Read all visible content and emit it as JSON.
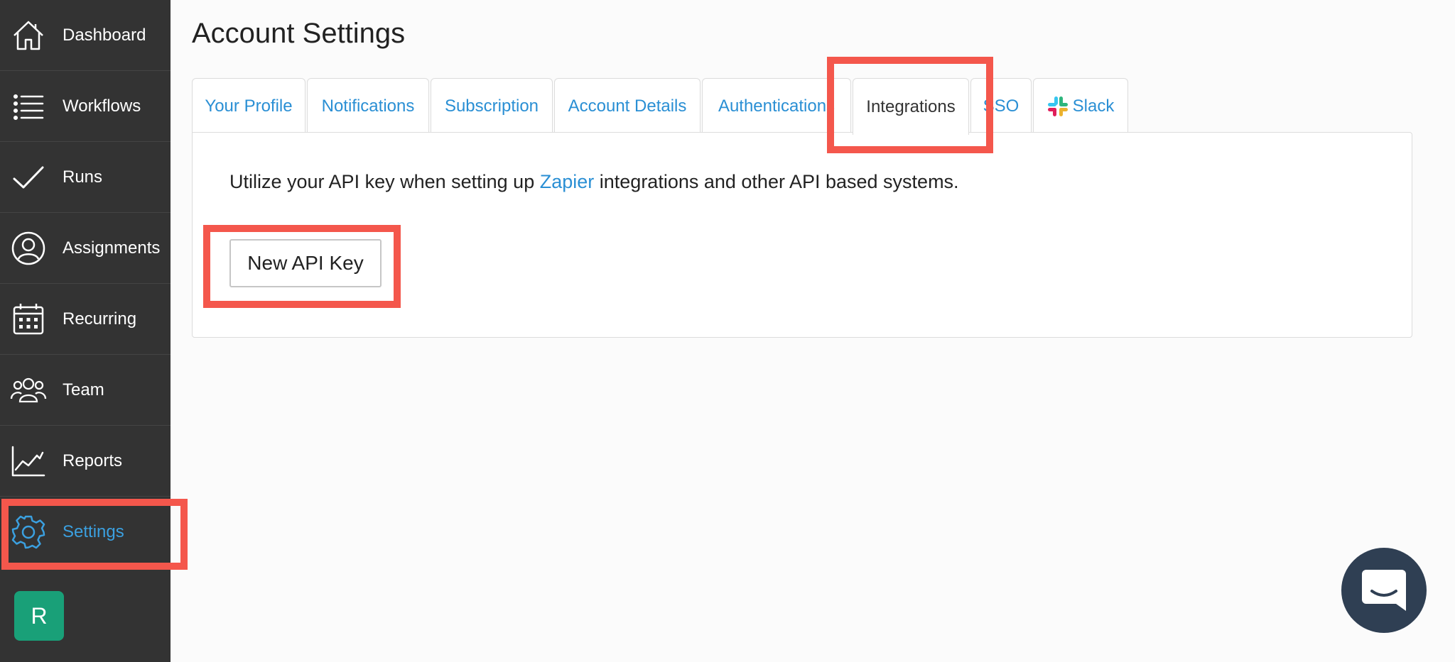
{
  "sidebar": {
    "items": [
      {
        "label": "Dashboard",
        "icon": "home-icon"
      },
      {
        "label": "Workflows",
        "icon": "list-icon"
      },
      {
        "label": "Runs",
        "icon": "checkmark-icon"
      },
      {
        "label": "Assignments",
        "icon": "user-circle-icon"
      },
      {
        "label": "Recurring",
        "icon": "calendar-icon"
      },
      {
        "label": "Team",
        "icon": "team-icon"
      },
      {
        "label": "Reports",
        "icon": "chart-icon"
      },
      {
        "label": "Settings",
        "icon": "gear-icon",
        "active": true
      }
    ],
    "avatar_initial": "R"
  },
  "page": {
    "title": "Account Settings"
  },
  "tabs": [
    {
      "label": "Your Profile"
    },
    {
      "label": "Notifications"
    },
    {
      "label": "Subscription"
    },
    {
      "label": "Account Details"
    },
    {
      "label": "Authentications"
    },
    {
      "label": "Integrations",
      "active": true
    },
    {
      "label": "SSO"
    },
    {
      "label": "Slack",
      "icon": "slack-logo-icon"
    }
  ],
  "integrations": {
    "text_before": "Utilize your API key when setting up ",
    "link_text": "Zapier",
    "text_after": " integrations and other API based systems.",
    "button_label": "New API Key"
  },
  "colors": {
    "sidebar_bg": "#333333",
    "active_link": "#3ba0e0",
    "highlight": "#f4574c",
    "avatar_bg": "#19a078",
    "chat_bg": "#2f3f53"
  }
}
